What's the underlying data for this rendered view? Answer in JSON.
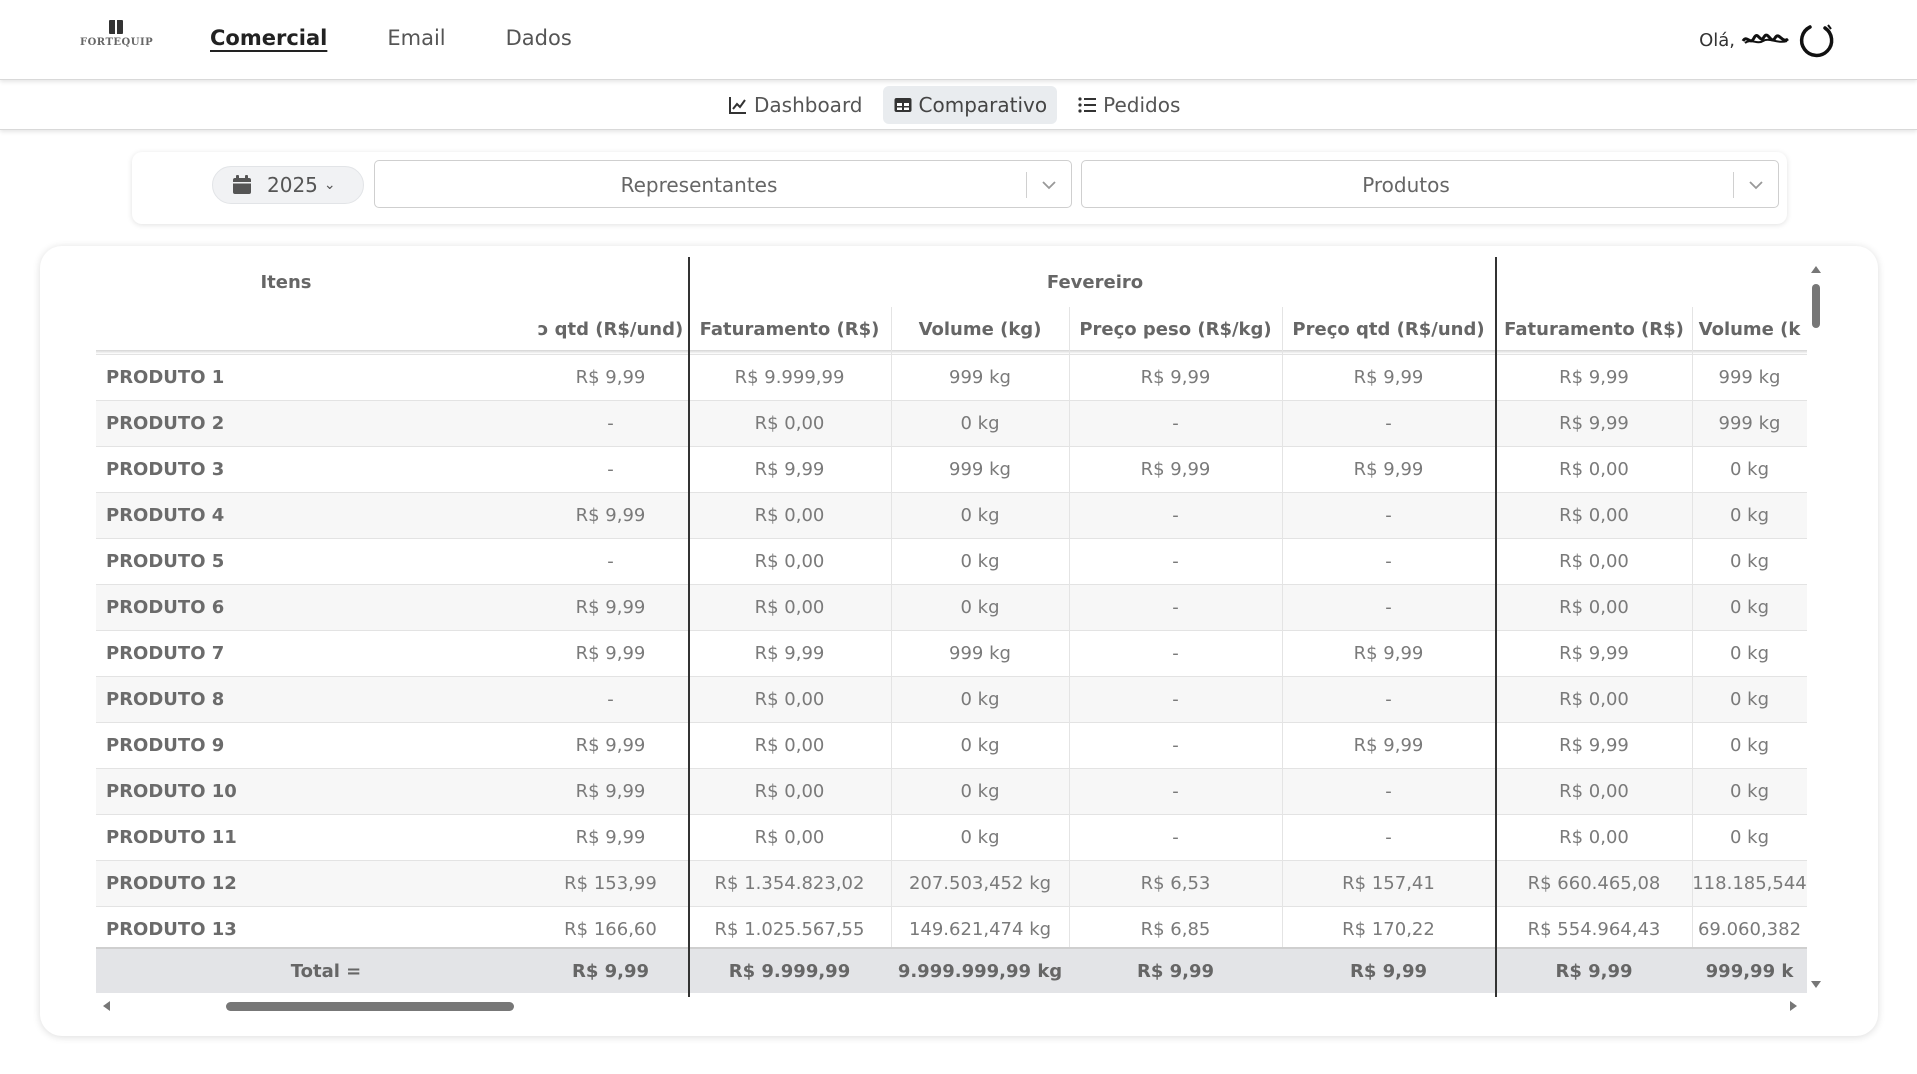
{
  "brand": {
    "logo_text": "FORTEQUIP"
  },
  "topnav": [
    {
      "label": "Comercial",
      "active": true
    },
    {
      "label": "Email",
      "active": false
    },
    {
      "label": "Dados",
      "active": false
    }
  ],
  "user": {
    "greeting": "Olá,"
  },
  "subnav": [
    {
      "label": "Dashboard",
      "icon": "line-chart-icon",
      "active": false
    },
    {
      "label": "Comparativo",
      "icon": "table-icon",
      "active": true
    },
    {
      "label": "Pedidos",
      "icon": "list-icon",
      "active": false
    }
  ],
  "filters": {
    "year": "2025",
    "representantes_placeholder": "Representantes",
    "produtos_placeholder": "Produtos"
  },
  "table": {
    "group_items": "Itens",
    "group_month": "Fevereiro",
    "columns": [
      "",
      "ɔ qtd (R$/und)",
      "Faturamento (R$)",
      "Volume (kg)",
      "Preço peso (R$/kg)",
      "Preço qtd (R$/und)",
      "Faturamento (R$)",
      "Volume (k"
    ],
    "rows": [
      [
        "PRODUTO 1",
        "R$ 9,99",
        "R$ 9.999,99",
        "999 kg",
        "R$ 9,99",
        "R$ 9,99",
        "R$ 9,99",
        "999 kg"
      ],
      [
        "PRODUTO 2",
        "-",
        "R$ 0,00",
        "0 kg",
        "-",
        "-",
        "R$ 9,99",
        "999 kg"
      ],
      [
        "PRODUTO 3",
        "-",
        "R$ 9,99",
        "999 kg",
        "R$ 9,99",
        "R$ 9,99",
        "R$ 0,00",
        "0 kg"
      ],
      [
        "PRODUTO 4",
        "R$ 9,99",
        "R$ 0,00",
        "0 kg",
        "-",
        "-",
        "R$ 0,00",
        "0 kg"
      ],
      [
        "PRODUTO 5",
        "-",
        "R$ 0,00",
        "0 kg",
        "-",
        "-",
        "R$ 0,00",
        "0 kg"
      ],
      [
        "PRODUTO 6",
        "R$ 9,99",
        "R$ 0,00",
        "0 kg",
        "-",
        "-",
        "R$ 0,00",
        "0 kg"
      ],
      [
        "PRODUTO 7",
        "R$ 9,99",
        "R$ 9,99",
        "999 kg",
        "-",
        "R$ 9,99",
        "R$ 9,99",
        "0 kg"
      ],
      [
        "PRODUTO 8",
        "-",
        "R$ 0,00",
        "0 kg",
        "-",
        "-",
        "R$ 0,00",
        "0 kg"
      ],
      [
        "PRODUTO 9",
        "R$ 9,99",
        "R$ 0,00",
        "0 kg",
        "-",
        "R$ 9,99",
        "R$ 9,99",
        "0 kg"
      ],
      [
        "PRODUTO 10",
        "R$ 9,99",
        "R$ 0,00",
        "0 kg",
        "-",
        "-",
        "R$ 0,00",
        "0 kg"
      ],
      [
        "PRODUTO 11",
        "R$ 9,99",
        "R$ 0,00",
        "0 kg",
        "-",
        "-",
        "R$ 0,00",
        "0 kg"
      ],
      [
        "PRODUTO 12",
        "R$ 153,99",
        "R$ 1.354.823,02",
        "207.503,452 kg",
        "R$ 6,53",
        "R$ 157,41",
        "R$ 660.465,08",
        "118.185,544"
      ],
      [
        "PRODUTO 13",
        "R$ 166,60",
        "R$ 1.025.567,55",
        "149.621,474 kg",
        "R$ 6,85",
        "R$ 170,22",
        "R$ 554.964,43",
        "69.060,382"
      ]
    ],
    "total": [
      "Total =",
      "R$ 9,99",
      "R$ 9.999,99",
      "9.999.999,99 kg",
      "R$ 9,99",
      "R$ 9,99",
      "R$ 9,99",
      "999,99 k"
    ]
  }
}
